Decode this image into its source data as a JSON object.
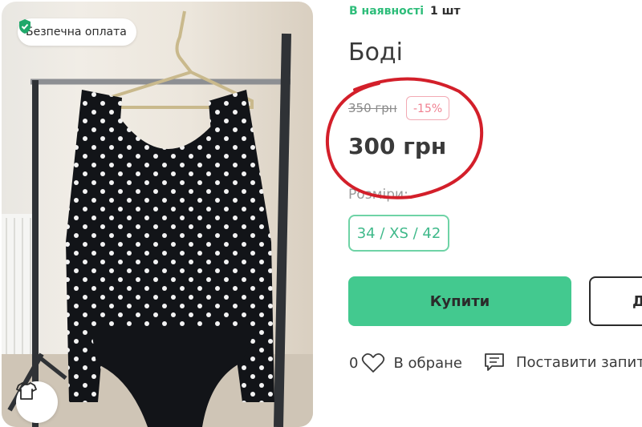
{
  "photo": {
    "badge_label": "Безпечна оплата",
    "badge_icon": "shield-check-icon",
    "corner_icon": "tshirt-icon"
  },
  "stock": {
    "status": "В наявності",
    "quantity": "1 шт"
  },
  "product": {
    "title": "Боді",
    "old_price": "350 грн",
    "discount": "-15%",
    "price": "300 грн",
    "sizes_label": "Розміри:",
    "size": "34 / XS / 42"
  },
  "actions": {
    "buy_label": "Купити",
    "second_label": "Д",
    "favorites_count": "0",
    "favorites_label": "В обране",
    "ask_label": "Поставити запита"
  },
  "colors": {
    "accent_green": "#43c98f",
    "stock_green": "#2ebd7a",
    "discount_pink": "#f07f8f",
    "annotation_red": "#d31f2a"
  }
}
